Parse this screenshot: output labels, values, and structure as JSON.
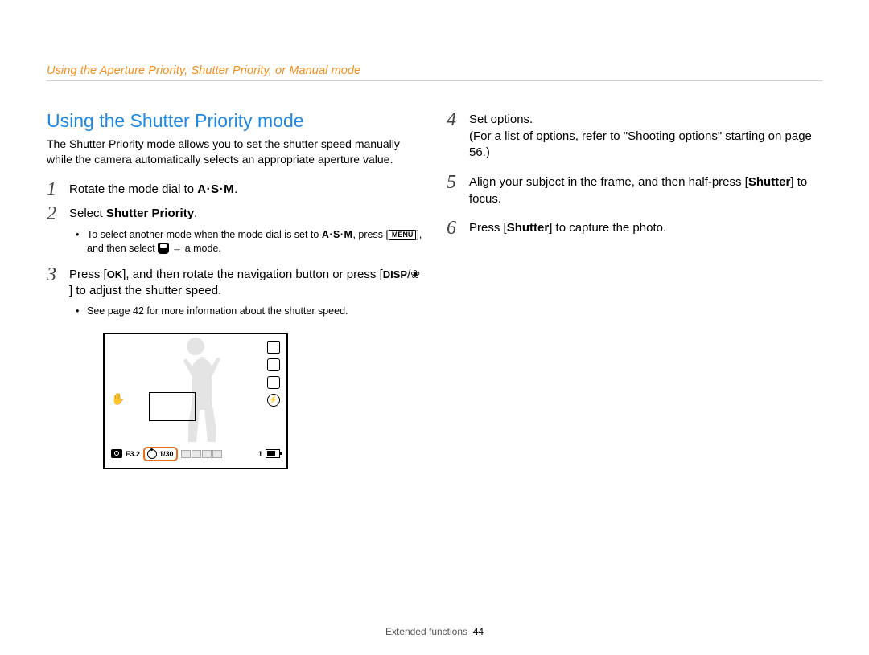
{
  "breadcrumb": "Using the Aperture Priority, Shutter Priority, or Manual mode",
  "section_title": "Using the Shutter Priority mode",
  "intro": "The Shutter Priority mode allows you to set the shutter speed manually while the camera automatically selects an appropriate aperture value.",
  "steps": {
    "s1": {
      "num": "1",
      "text_pre": "Rotate the mode dial to ",
      "mode_label": "A·S·M",
      "text_post": "."
    },
    "s2": {
      "num": "2",
      "text_pre": "Select ",
      "bold": "Shutter Priority",
      "text_post": "."
    },
    "s2_sub_a_pre": "To select another mode when the mode dial is set to ",
    "s2_sub_a_mode": "A·S·M",
    "s2_sub_a_mid": ", press [",
    "s2_sub_a_menu": "MENU",
    "s2_sub_a_post": "], and then select ",
    "s2_sub_a_arrow": " → a mode.",
    "s3": {
      "num": "3",
      "pre": "Press [",
      "ok": "OK",
      "mid1": "], and then rotate the navigation button or press [",
      "disp": "DISP",
      "slash": "/",
      "macro": "❀",
      "post": "] to adjust the shutter speed."
    },
    "s3_sub": "See page 42 for more information about the shutter speed.",
    "s4": {
      "num": "4",
      "line1": "Set options.",
      "line2": "(For a list of options, refer to \"Shooting options\" starting on page 56.)"
    },
    "s5": {
      "num": "5",
      "pre": "Align your subject in the frame, and then half-press [",
      "bold": "Shutter",
      "post": "] to focus."
    },
    "s6": {
      "num": "6",
      "pre": "Press [",
      "bold": "Shutter",
      "post": "] to capture the photo."
    }
  },
  "screen": {
    "aperture": "F3.2",
    "speed": "1/30",
    "shots": "1"
  },
  "footer": {
    "section": "Extended functions",
    "page": "44"
  }
}
